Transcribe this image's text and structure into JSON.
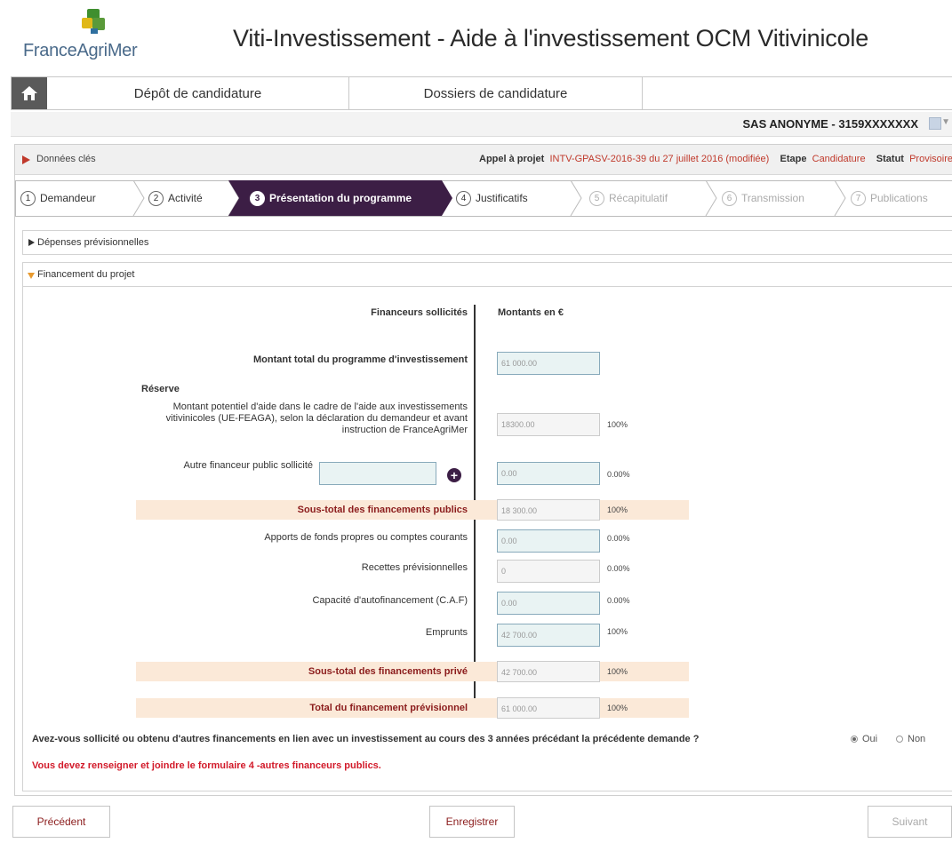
{
  "header": {
    "logo_text": "FranceAgriMer",
    "title": "Viti-Investissement - Aide à l'investissement OCM Vitivinicole"
  },
  "nav": {
    "tab1": "Dépôt de candidature",
    "tab2": "Dossiers de candidature"
  },
  "user": {
    "label": "SAS ANONYME - 3159XXXXXXX"
  },
  "keydata": {
    "label": "Données clés",
    "appel_label": "Appel à projet",
    "appel_value": "INTV-GPASV-2016-39 du 27 juillet 2016 (modifiée)",
    "etape_label": "Etape",
    "etape_value": "Candidature",
    "statut_label": "Statut",
    "statut_value": "Provisoire"
  },
  "steps": [
    {
      "num": "1",
      "label": "Demandeur"
    },
    {
      "num": "2",
      "label": "Activité"
    },
    {
      "num": "3",
      "label": "Présentation du programme"
    },
    {
      "num": "4",
      "label": "Justificatifs"
    },
    {
      "num": "5",
      "label": "Récapitulatif"
    },
    {
      "num": "6",
      "label": "Transmission"
    },
    {
      "num": "7",
      "label": "Publications"
    }
  ],
  "sections": {
    "depenses": "Dépenses prévisionnelles",
    "financement": "Financement du projet"
  },
  "table": {
    "col_financeurs": "Financeurs sollicités",
    "col_montants": "Montants en €",
    "montant_total_label": "Montant total du programme d'investissement",
    "montant_total_value": "61 000.00",
    "reserve_label": "Réserve",
    "potentiel_label": "Montant potentiel d'aide dans le cadre de l'aide aux investissements vitivinicoles (UE-FEAGA), selon la déclaration du demandeur et avant instruction de FranceAgriMer",
    "potentiel_value": "18300.00",
    "potentiel_pct": "100%",
    "autre_label": "Autre financeur public sollicité",
    "autre_input": "",
    "autre_value": "0.00",
    "autre_pct": "0.00%",
    "st_public_label": "Sous-total des financements publics",
    "st_public_value": "18 300.00",
    "st_public_pct": "100%",
    "apports_label": "Apports de fonds propres ou comptes courants",
    "apports_value": "0.00",
    "apports_pct": "0.00%",
    "recettes_label": "Recettes prévisionnelles",
    "recettes_value": "0",
    "recettes_pct": "0.00%",
    "caf_label": "Capacité d'autofinancement (C.A.F)",
    "caf_value": "0.00",
    "caf_pct": "0.00%",
    "emprunts_label": "Emprunts",
    "emprunts_value": "42 700.00",
    "emprunts_pct": "100%",
    "st_prive_label": "Sous-total des financements privé",
    "st_prive_value": "42 700.00",
    "st_prive_pct": "100%",
    "total_label": "Total du financement prévisionnel",
    "total_value": "61 000.00",
    "total_pct": "100%"
  },
  "question": {
    "text": "Avez-vous sollicité ou obtenu d'autres financements en lien avec un investissement au cours des 3 années précédant la précédente demande ?",
    "oui": "Oui",
    "non": "Non",
    "selected": "Oui"
  },
  "warning": "Vous devez renseigner et joindre le formulaire 4 -autres financeurs publics.",
  "buttons": {
    "prev": "Précédent",
    "save": "Enregistrer",
    "next": "Suivant"
  },
  "colors": {
    "active_step": "#3c1e45",
    "red": "#c0392b",
    "highlight": "#fbe9d8"
  }
}
